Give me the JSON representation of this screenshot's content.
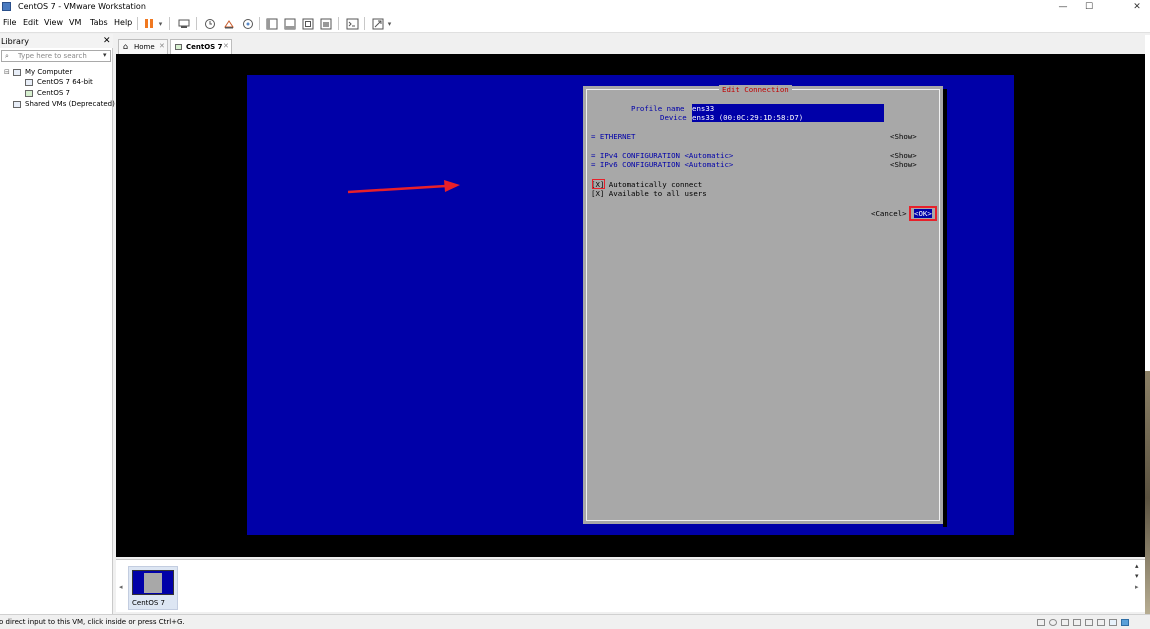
{
  "window": {
    "title": "CentOS 7 - VMware Workstation",
    "minimize": "—",
    "maximize": "☐",
    "close": "✕"
  },
  "menu": [
    "File",
    "Edit",
    "View",
    "VM",
    "Tabs",
    "Help"
  ],
  "library": {
    "title": "Library",
    "close": "✕",
    "search_placeholder": "Type here to search",
    "tree": {
      "root": "My Computer",
      "vms": [
        "CentOS 7 64-bit",
        "CentOS 7"
      ],
      "shared": "Shared VMs (Deprecated)"
    }
  },
  "tabs": [
    {
      "label": "Home",
      "close": "✕"
    },
    {
      "label": "CentOS 7",
      "close": "✕"
    }
  ],
  "nmtui": {
    "title": "Edit Connection",
    "profile_label": "Profile name",
    "profile_value": "ens33",
    "device_label": "Device",
    "device_value": "ens33 (00:0C:29:1D:58:D7)",
    "ethernet": "= ETHERNET",
    "ipv4": "= IPv4 CONFIGURATION <Automatic>",
    "ipv6": "= IPv6 CONFIGURATION <Automatic>",
    "show": "<Show>",
    "auto_connect": "[X] Automatically connect",
    "all_users": "[X] Available to all users",
    "cancel": "<Cancel>",
    "ok": "<OK>"
  },
  "thumbnails": [
    {
      "label": "CentOS 7"
    }
  ],
  "status": {
    "text": "o direct input to this VM, click inside or press Ctrl+G."
  },
  "colors": {
    "console_blue": "#0000a8",
    "dialog_gray": "#a8a8a8",
    "annotation_red": "#e8202a",
    "pause_orange": "#f07820"
  }
}
